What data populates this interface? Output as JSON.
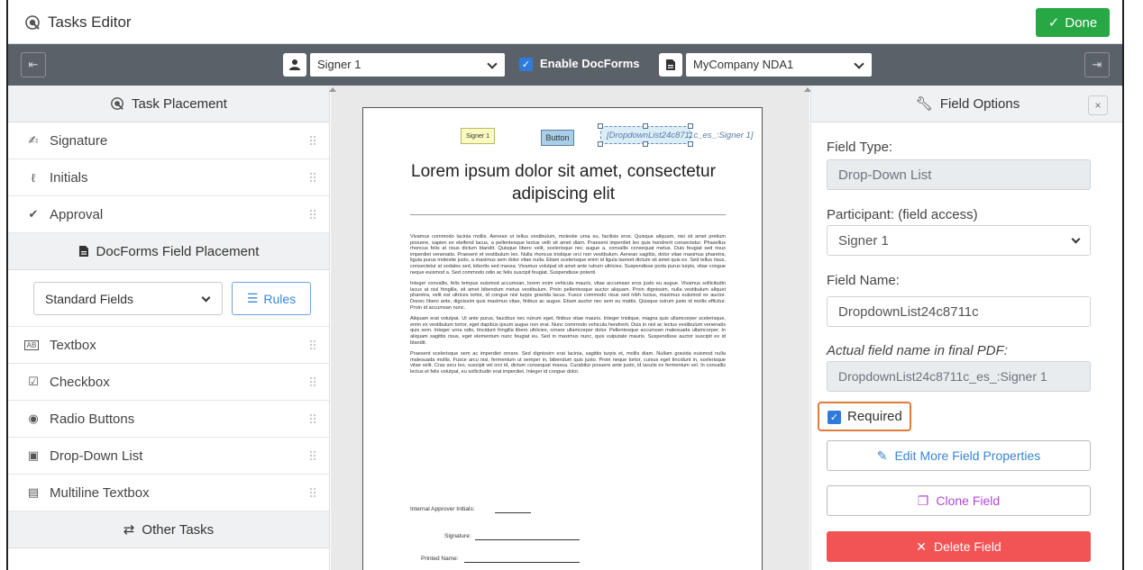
{
  "title_bar": {
    "title": "Tasks Editor",
    "done_label": "Done"
  },
  "toolbar": {
    "signer_select": "Signer 1",
    "enable_docforms_label": "Enable DocForms",
    "enable_docforms_checked": true,
    "template_select": "MyCompany NDA1"
  },
  "left_panel": {
    "task_placement_title": "Task Placement",
    "tasks": [
      {
        "label": "Signature",
        "icon": "signature-icon"
      },
      {
        "label": "Initials",
        "icon": "initials-icon"
      },
      {
        "label": "Approval",
        "icon": "approval-icon"
      }
    ],
    "docforms_title": "DocForms Field Placement",
    "field_set_select": "Standard Fields",
    "rules_label": "Rules",
    "fields": [
      {
        "label": "Textbox",
        "icon": "textbox-icon"
      },
      {
        "label": "Checkbox",
        "icon": "checkbox-icon"
      },
      {
        "label": "Radio Buttons",
        "icon": "radio-icon"
      },
      {
        "label": "Drop-Down List",
        "icon": "dropdown-icon"
      },
      {
        "label": "Multiline Textbox",
        "icon": "multiline-icon"
      }
    ],
    "other_tasks_title": "Other Tasks"
  },
  "document": {
    "field_signer": "Signer 1",
    "field_button": "Button",
    "field_dropdown": "[DropdownList24c8711c_es_:Signer 1]",
    "title": "Lorem ipsum dolor sit amet, consectetur adipiscing elit",
    "paragraphs": [
      "Vivamus commodo lacinia mollis. Aenean ut tellus vestibulum, molestie urna eu, facilisis eros. Quisque aliquam, nisi sit amet pretium posuere, sapien ex eleifend lacus, a pellentesque lectus velit sit amet diam. Praesent imperdiet leo quis hendrerit consectetur. Phasellus rhoncus felis at risus dictum blandit. Quisque libero velit, scelerisque nec augue a, convallis consequat metus. Duis feugiat sed risus imperdiet venenatis. Praesent et vestibulum leo. Nulla rhoncus tristique orci non vestibulum. Aenean sagittis, dolor vitae maximus pharetra, ligula purus molestie justo, a maximus sem dolor vitae nulla. Etiam scelerisque enim id ligula laoreet dictum sit amet quis ex. Sed tellus risus, consectetur at sodales sed, lobortis sed massa. Vivamus volutpat sit amet ante rutrum ultricies. Suspendisse porta purus turpis, vitae congue neque euismod a. Sed commodo odio ac felis suscipit feugiat. Suspendisse potenti.",
      "Integer convallis, felis tempus euismod accumsan, lorem enim vehicula mauris, vitae accumsan eros justo eu augue. Vivamus sollicitudin lacus at nisl fringilla, sit amet bibendum metus vestibulum. Proin pellentesque auctor aliquam. Proin dignissim, nulla vestibulum aliquet pharetra, velit est ultrices tortor, id congue nisl turpis gravida lacus. Fusce commodo risus sed nibh luctus, maximus euismod ex auctor. Donec libero ante, dignissim quis maximus vitae, finibus ac augue. Etiam auctor nec sem eu mattis. Quisque rutrum justo id mollis efficitur. Proin id accumsan nunc.",
      "Aliquam erat volutpat. Ut ante purus, faucibus nec rutrum eget, finibus vitae mauris. Integer tristique, magna quis ullamcorper scelerisque, enim ex vestibulum tortor, eget dapibus ipsum augue non erat. Nunc commodo vehicula hendrerit. Duis in nisl ac lectus vestibulum venenatis quis sem. Integer urna odio, tincidunt fringilla libero ultricies, ornare ullamcorper dolor. Pellentesque accumsan malesuada ullamcorper. In aliquam sagittis risus, eget elementum nunc feugiat eu. Sed in maximus nunc, quis vulputate mauris. Suspendisse auctor suscipit ex id blandit.",
      "Praesent scelerisque sem ac imperdiet ornare. Sed dignissim erat lacinia, sagittis turpis et, mollis diam. Nullam gravida euismod nulla malesuada mollis. Fusce arcu nisi, fermentum ut semper in, bibendum quis justo. Proin neque tortor, cursus eget tincidunt in, scelerisque vitae velit. Cras arcu leo, suscipit vel orci id, dictum consequat massa. Curabitur posuere ante justo, id iaculis ex fermentum vel. In convallis lectus et felis volutpat, eu sollicitudin erat imperdiet. Integer id congue dolor."
    ],
    "approver_label": "Internal Approver Initials:",
    "signature_label": "Signature:",
    "printed_name_label": "Printed Name:"
  },
  "field_options": {
    "title": "Field Options",
    "close_label": "×",
    "field_type_label": "Field Type:",
    "field_type_value": "Drop-Down List",
    "participant_label": "Participant: (field access)",
    "participant_value": "Signer 1",
    "field_name_label": "Field Name:",
    "field_name_value": "DropdownList24c8711c",
    "actual_name_label": "Actual field name in final PDF:",
    "actual_name_value": "DropdownList24c8711c_es_:Signer 1",
    "required_label": "Required",
    "required_checked": true,
    "edit_more_label": "Edit More Field Properties",
    "clone_label": "Clone Field",
    "delete_label": "Delete Field"
  },
  "colors": {
    "done_green": "#28a745",
    "toolbar_gray": "#5b6168",
    "accent_blue": "#2f7bdc",
    "delete_red": "#f25354",
    "clone_purple": "#b14bd6",
    "highlight_orange": "#e07b39"
  }
}
